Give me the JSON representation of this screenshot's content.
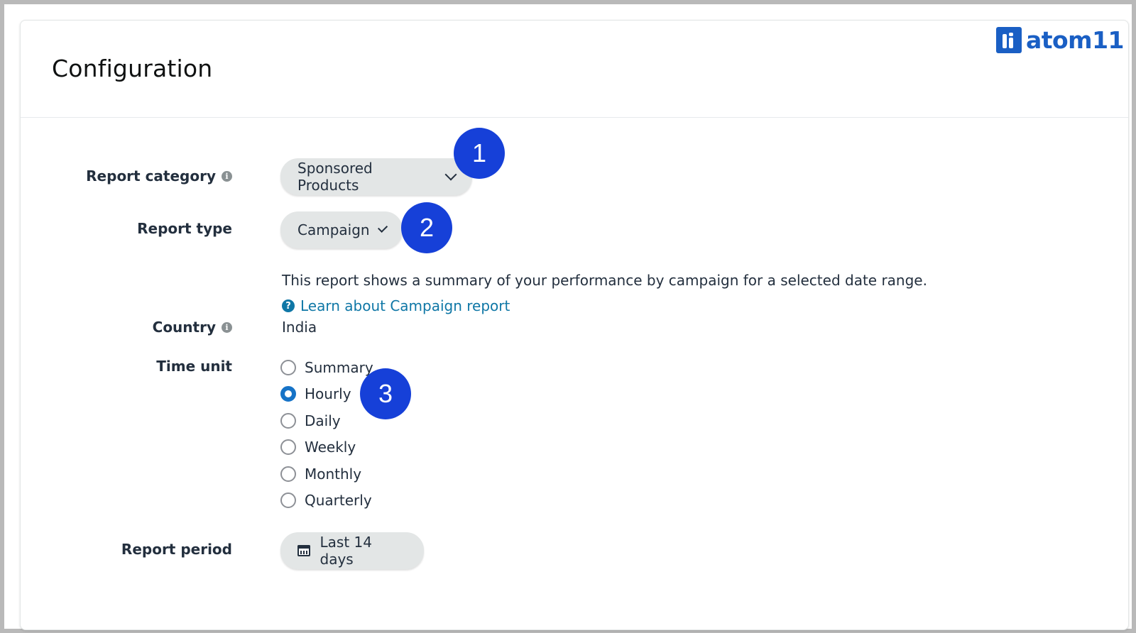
{
  "header": {
    "title": "Configuration",
    "logo_text": "atom11"
  },
  "colors": {
    "badge": "#1640d8",
    "link": "#0f77a6",
    "radio_selected": "#1673c7",
    "logo": "#1a5fc4"
  },
  "form": {
    "report_category": {
      "label": "Report category",
      "value": "Sponsored Products",
      "icon": "info-icon"
    },
    "report_type": {
      "label": "Report type",
      "value": "Campaign",
      "description": "This report shows a summary of your performance by campaign for a selected date range.",
      "learn_link": "Learn about Campaign report"
    },
    "country": {
      "label": "Country",
      "value": "India",
      "icon": "info-icon"
    },
    "time_unit": {
      "label": "Time unit",
      "options": [
        "Summary",
        "Hourly",
        "Daily",
        "Weekly",
        "Monthly",
        "Quarterly"
      ],
      "selected": "Hourly"
    },
    "report_period": {
      "label": "Report period",
      "value": "Last 14 days",
      "icon": "calendar-icon"
    }
  },
  "annotations": {
    "step1": "1",
    "step2": "2",
    "step3": "3"
  }
}
